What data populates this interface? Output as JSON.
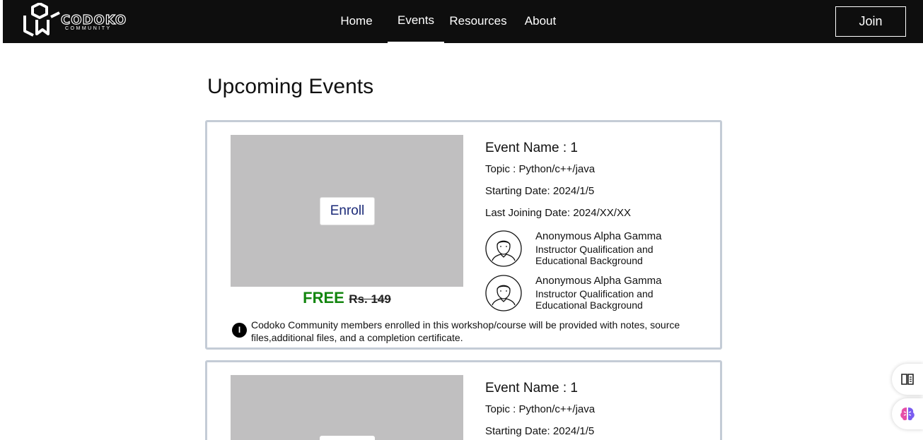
{
  "brand": {
    "name": "CODOKO",
    "sub": "COMMUNITY"
  },
  "nav": {
    "links": [
      {
        "label": "Home"
      },
      {
        "label": "Events"
      },
      {
        "label": "Resources"
      },
      {
        "label": "About"
      }
    ],
    "active": "Events",
    "join_label": "Join"
  },
  "page": {
    "title": "Upcoming Events"
  },
  "events": [
    {
      "enroll_label": "Enroll",
      "price_free": "FREE",
      "price_old": "Rs. 149",
      "name": "Event Name : 1",
      "topic": "Topic : Python/c++/java",
      "start": "Starting Date: 2024/1/5",
      "last_join": "Last Joining Date: 2024/XX/XX",
      "instructors": [
        {
          "name": "Anonymous Alpha Gamma",
          "qualification": "Instructor Qualification and Educational Background"
        },
        {
          "name": "Anonymous Alpha Gamma",
          "qualification": "Instructor Qualification and Educational Background"
        }
      ],
      "note_icon": "I",
      "note": "Codoko Community members enrolled in this workshop/course will be provided with notes, source files,additional files, and a completion certificate."
    },
    {
      "name": "Event Name : 1",
      "topic": "Topic : Python/c++/java",
      "start": "Starting Date: 2024/1/5"
    }
  ],
  "colors": {
    "nav_bg": "#0e0e0e",
    "free": "#13860f",
    "enroll_text": "#1b2a78",
    "card_border": "#c4ccd6",
    "image_placeholder": "#c0bfc0"
  },
  "icons": [
    "logo-icon",
    "avatar-icon",
    "info-icon",
    "reader-icon",
    "ai-brain-icon"
  ]
}
